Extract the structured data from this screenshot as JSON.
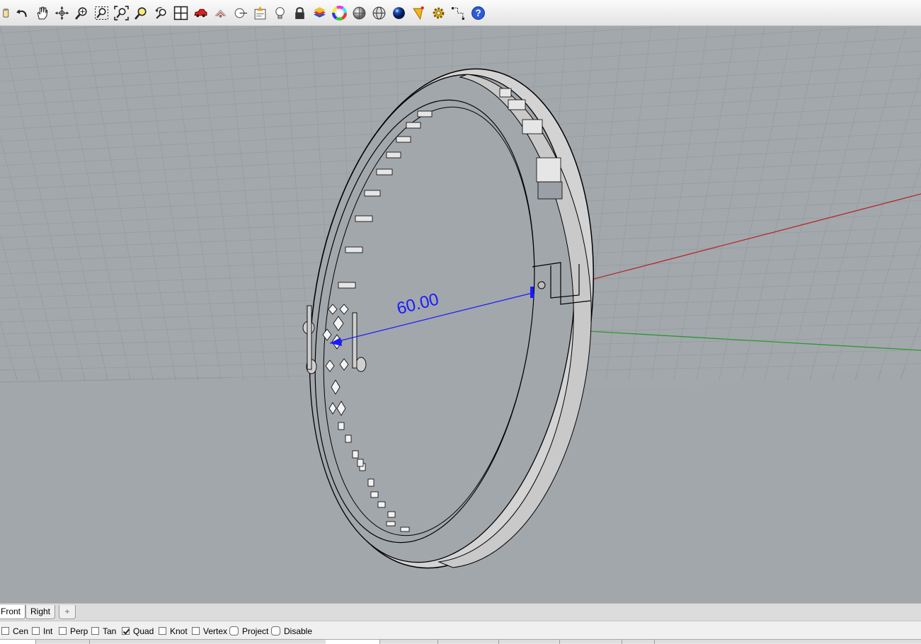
{
  "toolbar": {
    "buttons": [
      {
        "name": "save-icon"
      },
      {
        "name": "undo-icon"
      },
      {
        "name": "pan-hand-icon"
      },
      {
        "name": "rotate-view-icon"
      },
      {
        "name": "zoom-dynamic-icon"
      },
      {
        "name": "zoom-window-icon"
      },
      {
        "name": "zoom-extents-icon"
      },
      {
        "name": "zoom-selected-icon"
      },
      {
        "name": "undo-view-change-icon"
      },
      {
        "name": "four-viewports-icon"
      },
      {
        "name": "car-icon"
      },
      {
        "name": "select-filter-icon"
      },
      {
        "name": "distance-icon"
      },
      {
        "name": "object-properties-icon"
      },
      {
        "name": "light-bulb-icon"
      },
      {
        "name": "lock-icon"
      },
      {
        "name": "layer-icon"
      },
      {
        "name": "color-wheel-icon"
      },
      {
        "name": "shaded-sphere-icon"
      },
      {
        "name": "wireframe-sphere-icon"
      },
      {
        "name": "rendered-sphere-icon"
      },
      {
        "name": "analysis-icon"
      },
      {
        "name": "options-gear-icon"
      },
      {
        "name": "grid-snap-icon"
      },
      {
        "name": "help-icon"
      }
    ]
  },
  "viewport": {
    "dimension_label": "60.00",
    "colors": {
      "background": "#a2a7ac",
      "grid": "#8d9297",
      "x_axis": "#b02a2a",
      "y_axis": "#2a9a2a",
      "dimension": "#1a1aff"
    }
  },
  "tabs": {
    "items": [
      "Front",
      "Right"
    ],
    "add_icon": "add-tab-icon"
  },
  "osnap": {
    "items": [
      {
        "label": "Cen",
        "checked": false
      },
      {
        "label": "Int",
        "checked": false
      },
      {
        "label": "Perp",
        "checked": false
      },
      {
        "label": "Tan",
        "checked": false
      },
      {
        "label": "Quad",
        "checked": true
      },
      {
        "label": "Knot",
        "checked": false
      },
      {
        "label": "Vertex",
        "checked": false
      },
      {
        "label": "Project",
        "checked": false
      },
      {
        "label": "Disable",
        "checked": false
      }
    ]
  }
}
